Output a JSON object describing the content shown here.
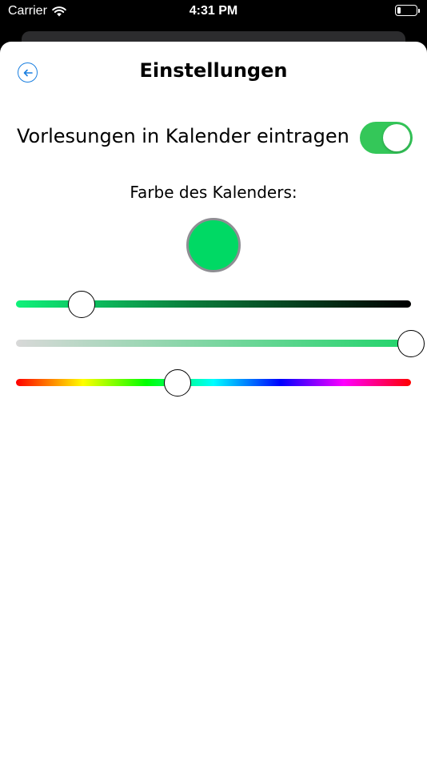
{
  "status_bar": {
    "carrier": "Carrier",
    "time": "4:31 PM",
    "battery_level": 0.2
  },
  "nav": {
    "back_icon": "arrow-left-circle-icon",
    "title": "Einstellungen"
  },
  "settings": {
    "calendar_toggle": {
      "label": "Vorlesungen in Kalender eintragen",
      "on": true
    },
    "color_heading": "Farbe des Kalenders:",
    "selected_color": "#00d964",
    "sliders": {
      "brightness": 0.165,
      "saturation": 1.0,
      "hue": 0.409
    }
  },
  "colors": {
    "accent_blue": "#1a7fe0",
    "toggle_green": "#34c759"
  }
}
